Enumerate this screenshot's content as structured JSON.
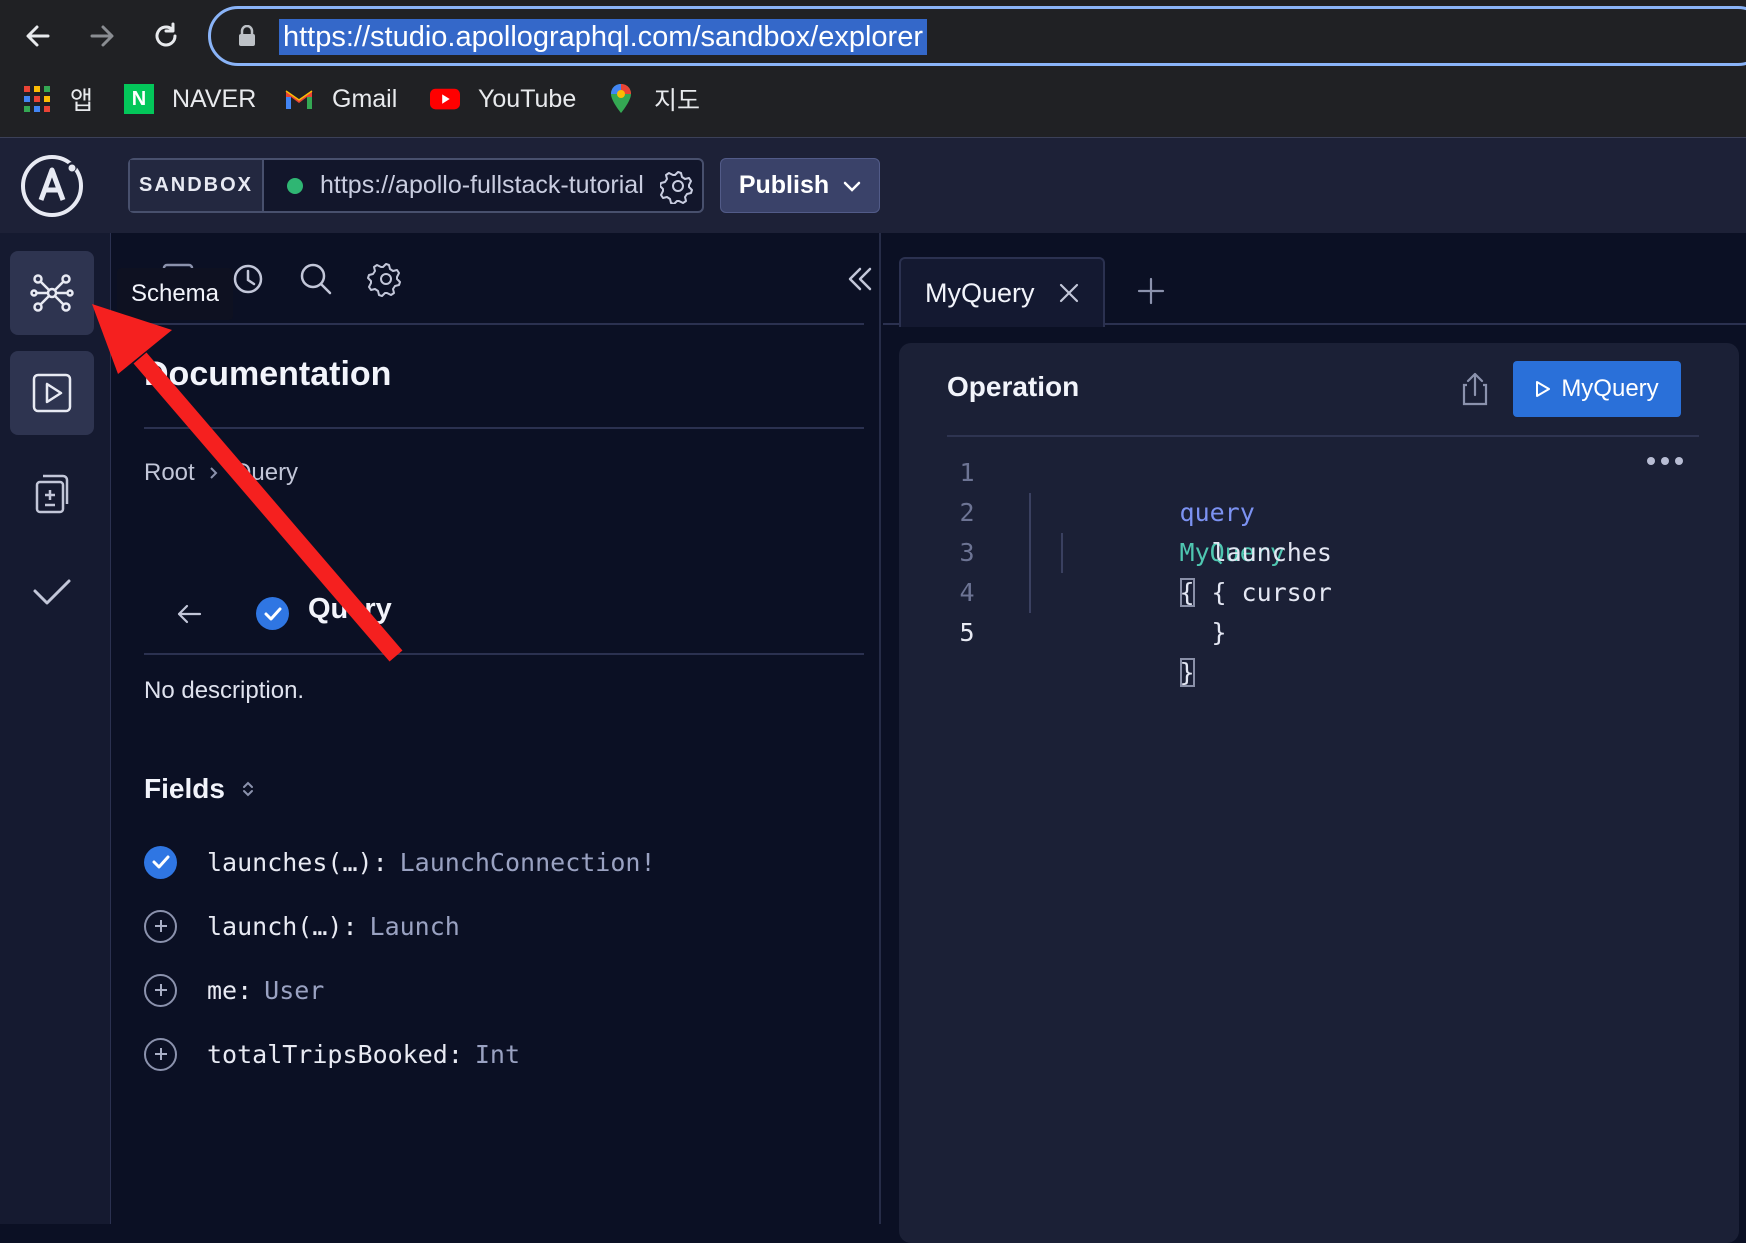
{
  "browser": {
    "url": "https://studio.apollographql.com/sandbox/explorer",
    "bookmarks": [
      {
        "label": "앱",
        "icon": "apps-grid-icon"
      },
      {
        "label": "NAVER",
        "icon": "naver-icon"
      },
      {
        "label": "Gmail",
        "icon": "gmail-icon"
      },
      {
        "label": "YouTube",
        "icon": "youtube-icon"
      },
      {
        "label": "지도",
        "icon": "maps-pin-icon"
      }
    ]
  },
  "header": {
    "sandbox_label": "SANDBOX",
    "endpoint_url": "https://apollo-fullstack-tutorial.herokuapp.com/graphql",
    "publish_label": "Publish"
  },
  "tooltip": "Schema",
  "documentation": {
    "title": "Documentation",
    "breadcrumb": [
      "Root",
      "Query"
    ],
    "type_name": "Query",
    "description": "No description.",
    "fields_label": "Fields",
    "fields": [
      {
        "name": "launches(…):",
        "type": "LaunchConnection!",
        "selected": true
      },
      {
        "name": "launch(…):",
        "type": "Launch",
        "selected": false
      },
      {
        "name": "me:",
        "type": "User",
        "selected": false
      },
      {
        "name": "totalTripsBooked:",
        "type": "Int",
        "selected": false
      }
    ]
  },
  "editor": {
    "tab_label": "MyQuery",
    "operation_title": "Operation",
    "run_label": "MyQuery",
    "lines": [
      {
        "num": "1",
        "kw": "query",
        "name": "MyQuery",
        "punc": "{"
      },
      {
        "num": "2",
        "field": "launches",
        "punc": "{"
      },
      {
        "num": "3",
        "field": "cursor"
      },
      {
        "num": "4",
        "punc": "}"
      },
      {
        "num": "5",
        "punc": "}"
      }
    ]
  },
  "colors": {
    "accent_blue": "#2f76e3",
    "annotation_red": "#f5201f",
    "status_green": "#2fb673"
  }
}
